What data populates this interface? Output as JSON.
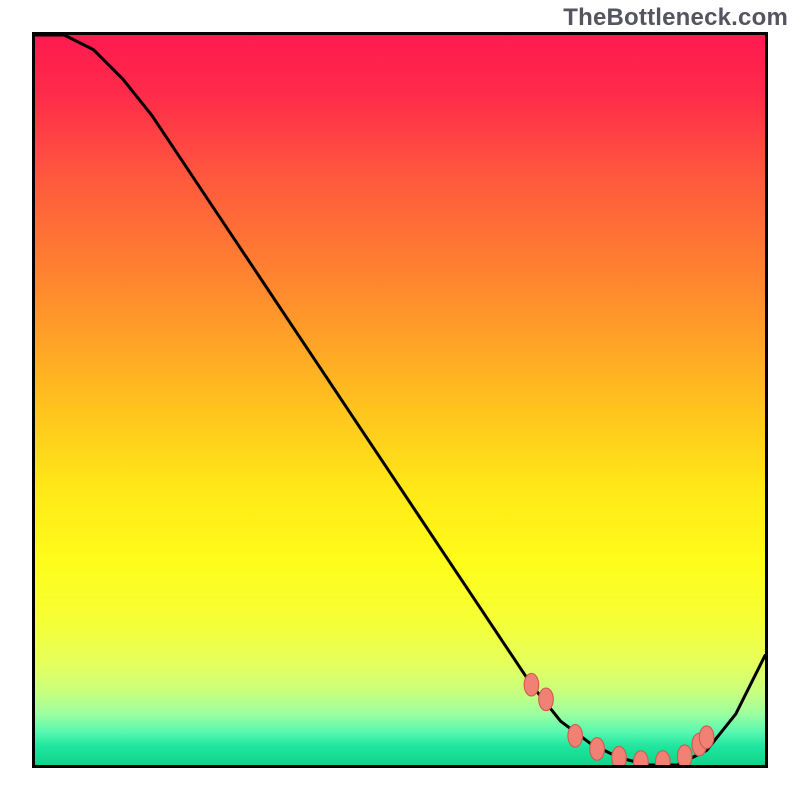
{
  "watermark": "TheBottleneck.com",
  "colors": {
    "curve": "#000000",
    "marker_fill": "#f08174",
    "marker_stroke": "#cf5a4e",
    "border": "#000000"
  },
  "gradient_stops": [
    {
      "offset": 0.0,
      "color": "#ff1a50"
    },
    {
      "offset": 0.08,
      "color": "#ff2b4a"
    },
    {
      "offset": 0.2,
      "color": "#ff5a3d"
    },
    {
      "offset": 0.35,
      "color": "#ff8a2e"
    },
    {
      "offset": 0.5,
      "color": "#ffbf1f"
    },
    {
      "offset": 0.62,
      "color": "#ffe817"
    },
    {
      "offset": 0.72,
      "color": "#fffc1a"
    },
    {
      "offset": 0.8,
      "color": "#f6ff34"
    },
    {
      "offset": 0.86,
      "color": "#e6ff5c"
    },
    {
      "offset": 0.9,
      "color": "#c8ff7e"
    },
    {
      "offset": 0.93,
      "color": "#9cffa0"
    },
    {
      "offset": 0.955,
      "color": "#58f8b0"
    },
    {
      "offset": 0.975,
      "color": "#1ee59f"
    },
    {
      "offset": 1.0,
      "color": "#0fd48a"
    }
  ],
  "chart_data": {
    "type": "line",
    "title": "",
    "xlabel": "",
    "ylabel": "",
    "xlim": [
      0,
      100
    ],
    "ylim": [
      0,
      100
    ],
    "series": [
      {
        "name": "bottleneck-curve",
        "x": [
          0,
          4,
          8,
          12,
          16,
          20,
          24,
          28,
          32,
          36,
          40,
          44,
          48,
          52,
          56,
          60,
          64,
          68,
          72,
          76,
          80,
          84,
          88,
          92,
          96,
          100
        ],
        "y": [
          100,
          100,
          98,
          94,
          89,
          83,
          77,
          71,
          65,
          59,
          53,
          47,
          41,
          35,
          29,
          23,
          17,
          11,
          6,
          3,
          1,
          0,
          0,
          2,
          7,
          15
        ]
      }
    ],
    "markers": {
      "name": "highlight-points",
      "x": [
        68,
        70,
        74,
        77,
        80,
        83,
        86,
        89,
        91,
        92
      ],
      "y": [
        11,
        9,
        4,
        2.2,
        1.0,
        0.4,
        0.4,
        1.2,
        2.8,
        3.8
      ]
    }
  }
}
